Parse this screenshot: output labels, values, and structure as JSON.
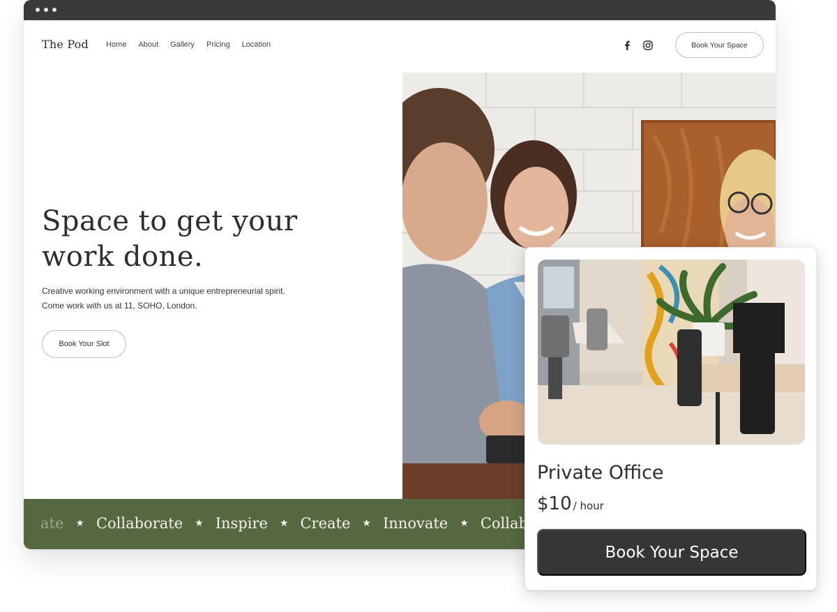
{
  "site": {
    "logo": "The Pod",
    "nav": [
      "Home",
      "About",
      "Gallery",
      "Pricing",
      "Location"
    ],
    "social_icons": [
      "facebook-icon",
      "instagram-icon"
    ],
    "header_cta": "Book Your Space"
  },
  "hero": {
    "title": "Space to get your work done.",
    "subtitle": "Creative working environment with a unique entrepreneurial spirit. Come work with us at 11, SOHO, London.",
    "cta": "Book Your Slot"
  },
  "ticker": {
    "words": [
      "ate",
      "Collaborate",
      "Inspire",
      "Create",
      "Innovate",
      "Collaborat"
    ],
    "separator": "★"
  },
  "card": {
    "title": "Private Office",
    "price": "$10",
    "unit": "/ hour",
    "button": "Book Your Space"
  },
  "colors": {
    "ticker_bg": "#55683f",
    "titlebar": "#3a3a3a",
    "card_button": "#363636"
  }
}
